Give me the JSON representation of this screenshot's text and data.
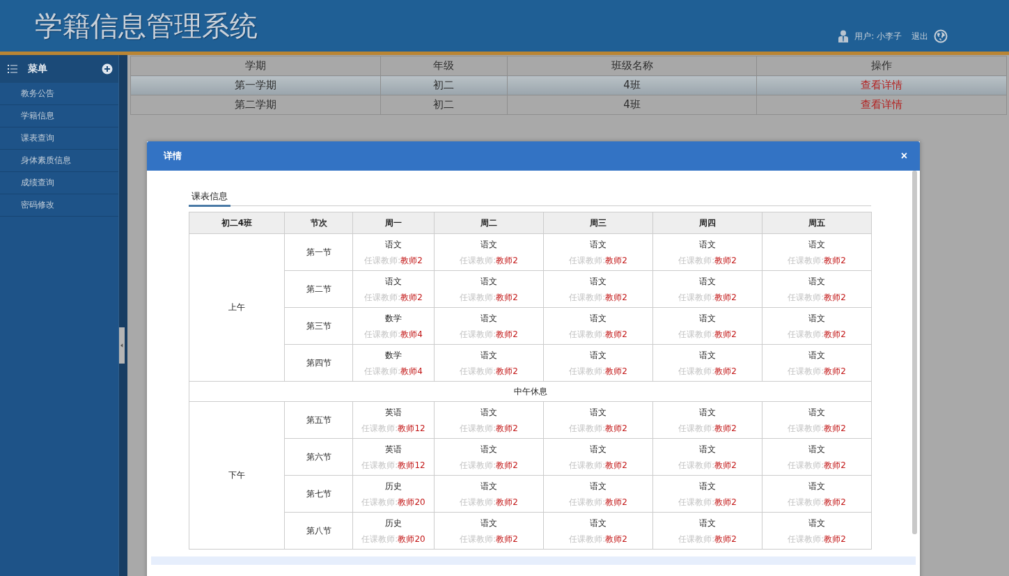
{
  "header": {
    "title": "学籍信息管理系统",
    "user_label": "用户: 小李子",
    "logout": "退出"
  },
  "sidebar": {
    "title": "菜单",
    "items": [
      {
        "label": "教务公告",
        "selected": false
      },
      {
        "label": "学籍信息",
        "selected": false
      },
      {
        "label": "课表查询",
        "selected": false
      },
      {
        "label": "身体素质信息",
        "selected": false
      },
      {
        "label": "成绩查询",
        "selected": false
      },
      {
        "label": "密码修改",
        "selected": false
      }
    ]
  },
  "table": {
    "columns": [
      "学期",
      "年级",
      "班级名称",
      "操作"
    ],
    "rows": [
      {
        "term": "第一学期",
        "grade": "初二",
        "class": "4班",
        "action": "查看详情",
        "selected": true
      },
      {
        "term": "第二学期",
        "grade": "初二",
        "class": "4班",
        "action": "查看详情",
        "selected": false
      }
    ]
  },
  "modal": {
    "title": "详情",
    "close": "×",
    "tab": "课表信息",
    "timetable": {
      "columns": [
        "初二4班",
        "节次",
        "周一",
        "周二",
        "周三",
        "周四",
        "周五"
      ],
      "sections": [
        {
          "kind": "session",
          "label": "上午",
          "rows": [
            {
              "period": "第一节",
              "cells": [
                {
                  "subject": "语文",
                  "teacher_label": "任课教师:",
                  "teacher": "教师2"
                },
                {
                  "subject": "语文",
                  "teacher_label": "任课教师:",
                  "teacher": "教师2"
                },
                {
                  "subject": "语文",
                  "teacher_label": "任课教师:",
                  "teacher": "教师2"
                },
                {
                  "subject": "语文",
                  "teacher_label": "任课教师:",
                  "teacher": "教师2"
                },
                {
                  "subject": "语文",
                  "teacher_label": "任课教师:",
                  "teacher": "教师2"
                }
              ]
            },
            {
              "period": "第二节",
              "cells": [
                {
                  "subject": "语文",
                  "teacher_label": "任课教师:",
                  "teacher": "教师2"
                },
                {
                  "subject": "语文",
                  "teacher_label": "任课教师:",
                  "teacher": "教师2"
                },
                {
                  "subject": "语文",
                  "teacher_label": "任课教师:",
                  "teacher": "教师2"
                },
                {
                  "subject": "语文",
                  "teacher_label": "任课教师:",
                  "teacher": "教师2"
                },
                {
                  "subject": "语文",
                  "teacher_label": "任课教师:",
                  "teacher": "教师2"
                }
              ]
            },
            {
              "period": "第三节",
              "cells": [
                {
                  "subject": "数学",
                  "teacher_label": "任课教师:",
                  "teacher": "教师4"
                },
                {
                  "subject": "语文",
                  "teacher_label": "任课教师:",
                  "teacher": "教师2"
                },
                {
                  "subject": "语文",
                  "teacher_label": "任课教师:",
                  "teacher": "教师2"
                },
                {
                  "subject": "语文",
                  "teacher_label": "任课教师:",
                  "teacher": "教师2"
                },
                {
                  "subject": "语文",
                  "teacher_label": "任课教师:",
                  "teacher": "教师2"
                }
              ]
            },
            {
              "period": "第四节",
              "cells": [
                {
                  "subject": "数学",
                  "teacher_label": "任课教师:",
                  "teacher": "教师4"
                },
                {
                  "subject": "语文",
                  "teacher_label": "任课教师:",
                  "teacher": "教师2"
                },
                {
                  "subject": "语文",
                  "teacher_label": "任课教师:",
                  "teacher": "教师2"
                },
                {
                  "subject": "语文",
                  "teacher_label": "任课教师:",
                  "teacher": "教师2"
                },
                {
                  "subject": "语文",
                  "teacher_label": "任课教师:",
                  "teacher": "教师2"
                }
              ]
            }
          ]
        },
        {
          "kind": "break",
          "label": "中午休息"
        },
        {
          "kind": "session",
          "label": "下午",
          "rows": [
            {
              "period": "第五节",
              "cells": [
                {
                  "subject": "英语",
                  "teacher_label": "任课教师:",
                  "teacher": "教师12"
                },
                {
                  "subject": "语文",
                  "teacher_label": "任课教师:",
                  "teacher": "教师2"
                },
                {
                  "subject": "语文",
                  "teacher_label": "任课教师:",
                  "teacher": "教师2"
                },
                {
                  "subject": "语文",
                  "teacher_label": "任课教师:",
                  "teacher": "教师2"
                },
                {
                  "subject": "语文",
                  "teacher_label": "任课教师:",
                  "teacher": "教师2"
                }
              ]
            },
            {
              "period": "第六节",
              "cells": [
                {
                  "subject": "英语",
                  "teacher_label": "任课教师:",
                  "teacher": "教师12"
                },
                {
                  "subject": "语文",
                  "teacher_label": "任课教师:",
                  "teacher": "教师2"
                },
                {
                  "subject": "语文",
                  "teacher_label": "任课教师:",
                  "teacher": "教师2"
                },
                {
                  "subject": "语文",
                  "teacher_label": "任课教师:",
                  "teacher": "教师2"
                },
                {
                  "subject": "语文",
                  "teacher_label": "任课教师:",
                  "teacher": "教师2"
                }
              ]
            },
            {
              "period": "第七节",
              "cells": [
                {
                  "subject": "历史",
                  "teacher_label": "任课教师:",
                  "teacher": "教师20"
                },
                {
                  "subject": "语文",
                  "teacher_label": "任课教师:",
                  "teacher": "教师2"
                },
                {
                  "subject": "语文",
                  "teacher_label": "任课教师:",
                  "teacher": "教师2"
                },
                {
                  "subject": "语文",
                  "teacher_label": "任课教师:",
                  "teacher": "教师2"
                },
                {
                  "subject": "语文",
                  "teacher_label": "任课教师:",
                  "teacher": "教师2"
                }
              ]
            },
            {
              "period": "第八节",
              "cells": [
                {
                  "subject": "历史",
                  "teacher_label": "任课教师:",
                  "teacher": "教师20"
                },
                {
                  "subject": "语文",
                  "teacher_label": "任课教师:",
                  "teacher": "教师2"
                },
                {
                  "subject": "语文",
                  "teacher_label": "任课教师:",
                  "teacher": "教师2"
                },
                {
                  "subject": "语文",
                  "teacher_label": "任课教师:",
                  "teacher": "教师2"
                },
                {
                  "subject": "语文",
                  "teacher_label": "任课教师:",
                  "teacher": "教师2"
                }
              ]
            }
          ]
        }
      ]
    }
  }
}
